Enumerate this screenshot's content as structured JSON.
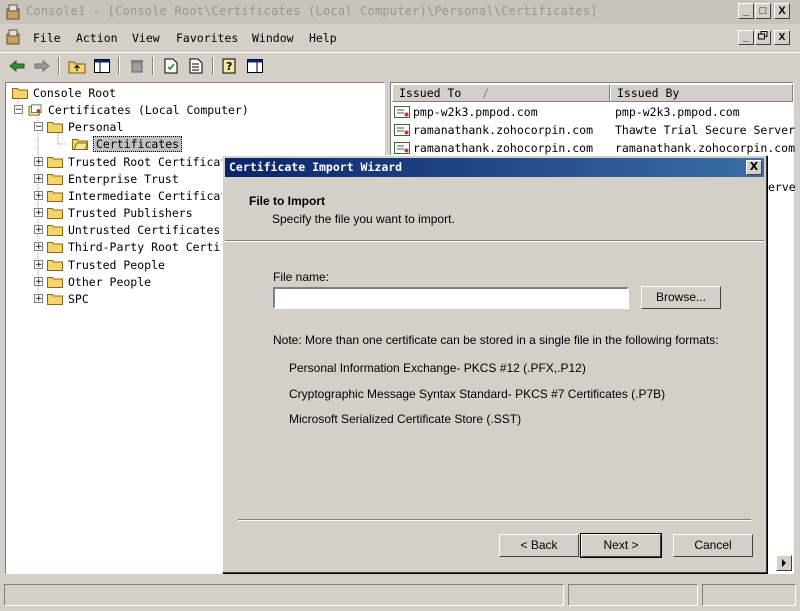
{
  "window": {
    "title": "Console1 - [Console Root\\Certificates (Local Computer)\\Personal\\Certificates]",
    "controls": {
      "minimize": "_",
      "maximize": "□",
      "close": "X"
    }
  },
  "menu": {
    "items": [
      "File",
      "Action",
      "View",
      "Favorites",
      "Window",
      "Help"
    ],
    "mdi": {
      "minimize": "_",
      "restore": "ฮ",
      "close": "X"
    }
  },
  "toolbar": {
    "icons": [
      "back-arrow-icon",
      "forward-arrow-icon",
      "up-folder-icon",
      "show-tree-icon",
      "delete-icon",
      "properties-icon",
      "export-list-icon",
      "help-icon",
      "action-pane-icon"
    ]
  },
  "tree": {
    "items": [
      {
        "label": "Console Root"
      },
      {
        "label": "Certificates (Local Computer)"
      },
      {
        "label": "Personal"
      },
      {
        "label": "Certificates"
      },
      {
        "label": "Trusted Root Certificat"
      },
      {
        "label": "Enterprise Trust"
      },
      {
        "label": "Intermediate Certificat"
      },
      {
        "label": "Trusted Publishers"
      },
      {
        "label": "Untrusted Certificates"
      },
      {
        "label": "Third-Party Root Certif"
      },
      {
        "label": "Trusted People"
      },
      {
        "label": "Other People"
      },
      {
        "label": "SPC"
      }
    ]
  },
  "list": {
    "columns": [
      "Issued To",
      "Issued By"
    ],
    "sort_indicator": "/",
    "rows": [
      {
        "issued_to": "pmp-w2k3.pmpod.com",
        "issued_by": "pmp-w2k3.pmpod.com"
      },
      {
        "issued_to": "ramanathank.zohocorpin.com",
        "issued_by": "Thawte Trial Secure Server"
      },
      {
        "issued_to": "ramanathank.zohocorpin.com",
        "issued_by": "ramanathank.zohocorpin.com"
      }
    ],
    "partial_text": "erve"
  },
  "dialog": {
    "title": "Certificate Import Wizard",
    "close": "X",
    "heading": "File to Import",
    "subheading": "Specify the file you want to import.",
    "file_label": "File name:",
    "file_value": "",
    "browse": "Browse...",
    "note": "Note:  More than one certificate can be stored in a single file in the following formats:",
    "formats": [
      "Personal Information Exchange- PKCS #12 (.PFX,.P12)",
      "Cryptographic Message Syntax Standard- PKCS #7 Certificates (.P7B)",
      "Microsoft Serialized Certificate Store (.SST)"
    ],
    "buttons": {
      "back": "< Back",
      "next": "Next >",
      "cancel": "Cancel"
    }
  },
  "colors": {
    "chrome": "#d4d0c8",
    "dialog_title_start": "#0a246a",
    "dialog_title_end": "#3a6ea5",
    "folder": "#f5d46e"
  }
}
